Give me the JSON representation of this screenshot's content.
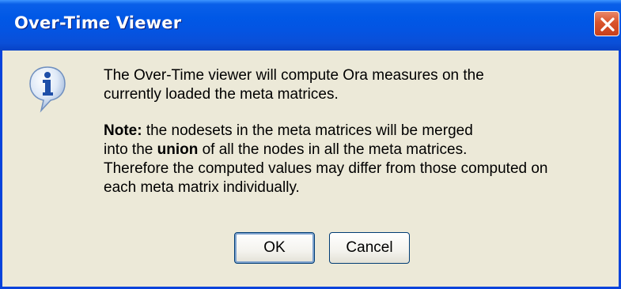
{
  "dialog": {
    "title": "Over-Time Viewer",
    "icon": "info-icon",
    "close_icon": "close-icon",
    "message": {
      "line1": "The Over-Time viewer will compute Ora measures on the",
      "line2": "currently loaded the meta matrices.",
      "note_label": "Note:",
      "note_line1_rest": " the nodesets in the meta matrices will be merged",
      "note_line2_pre": "into the ",
      "note_line2_bold": "union",
      "note_line2_post": " of all the nodes in all the meta matrices.",
      "note_line3": "Therefore the computed values may differ from those computed on",
      "note_line4": "each meta matrix individually."
    },
    "buttons": {
      "ok_label": "OK",
      "cancel_label": "Cancel"
    }
  },
  "colors": {
    "titlebar": "#0058e6",
    "window_bg": "#ece9d8",
    "close_button": "#d9542c",
    "button_border": "#003c74"
  }
}
